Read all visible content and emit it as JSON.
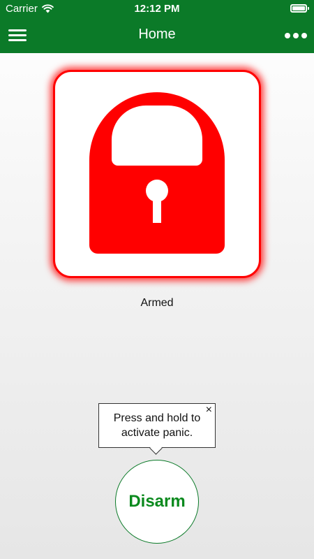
{
  "status_bar": {
    "carrier": "Carrier",
    "time": "12:12 PM",
    "wifi_icon": "wifi-icon",
    "battery_icon": "battery-full-icon"
  },
  "nav": {
    "title": "Home",
    "menu_icon": "hamburger-menu-icon",
    "more_icon": "more-dots-icon"
  },
  "security": {
    "status": "Armed",
    "lock_icon": "padlock-locked-icon"
  },
  "tooltip": {
    "line1": "Press and hold to",
    "line2": "activate panic.",
    "close_label": "×"
  },
  "action_button": {
    "label": "Disarm"
  },
  "colors": {
    "brand_green": "#0b7a28",
    "armed_red": "#ff0000",
    "button_text_green": "#0b8a1e"
  }
}
